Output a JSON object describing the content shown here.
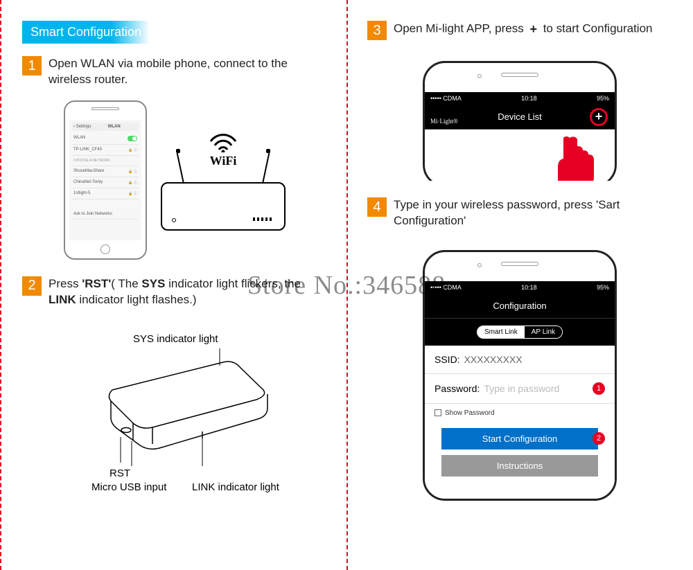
{
  "header": {
    "title": "Smart Configuration"
  },
  "watermark": "Store No.:346588",
  "steps": {
    "s1": {
      "num": "1",
      "text": "Open WLAN via mobile phone, connect to the wireless router."
    },
    "s2": {
      "num": "2",
      "prefix": "Press ",
      "b1": "'RST'",
      "mid": "( The ",
      "b2": "SYS",
      "mid2": " indicator light flickers, the ",
      "b3": "LINK",
      "suffix": " indicator light flashes.)"
    },
    "s3": {
      "num": "3",
      "prefix": "Open Mi-light APP, press ",
      "plus": "+",
      "suffix": " to start Configuration"
    },
    "s4": {
      "num": "4",
      "text": "Type in your wireless password, press 'Sart Configuration'"
    }
  },
  "labels": {
    "wifi": "WiFi",
    "sys": "SYS indicator light",
    "rst": "RST",
    "micro_usb": "Micro USB input",
    "link": "LINK indicator light"
  },
  "wlan": {
    "back": "‹ Settings",
    "title": "WLAN",
    "wlan_label": "WLAN",
    "connected": "TP-LINK_CF43",
    "others": "CHOOSE A NETWORK",
    "n1": "ShuceMacShare",
    "n2": "ChinaNet-Tsmly",
    "n3": "1stlight-5",
    "ask": "Ask to Join Networks"
  },
  "phone3": {
    "carrier": "••••• CDMA",
    "wifi_icon": "⋮",
    "time": "10:18",
    "battery": "95%",
    "brand": "Mi·Light®",
    "title": "Device List",
    "plus": "+"
  },
  "phone4": {
    "carrier": "••••• CDMA",
    "time": "10:18",
    "battery": "95%",
    "title": "Configuration",
    "tab1": "Smart Link",
    "tab2": "AP Link",
    "ssid_lbl": "SSID:",
    "ssid_val": "XXXXXXXXX",
    "pw_lbl": "Password:",
    "pw_ph": "Type in password",
    "badge1": "1",
    "show_pw": "Show Password",
    "btn1": "Start Configuration",
    "badge2": "2",
    "btn2": "Instructions"
  }
}
